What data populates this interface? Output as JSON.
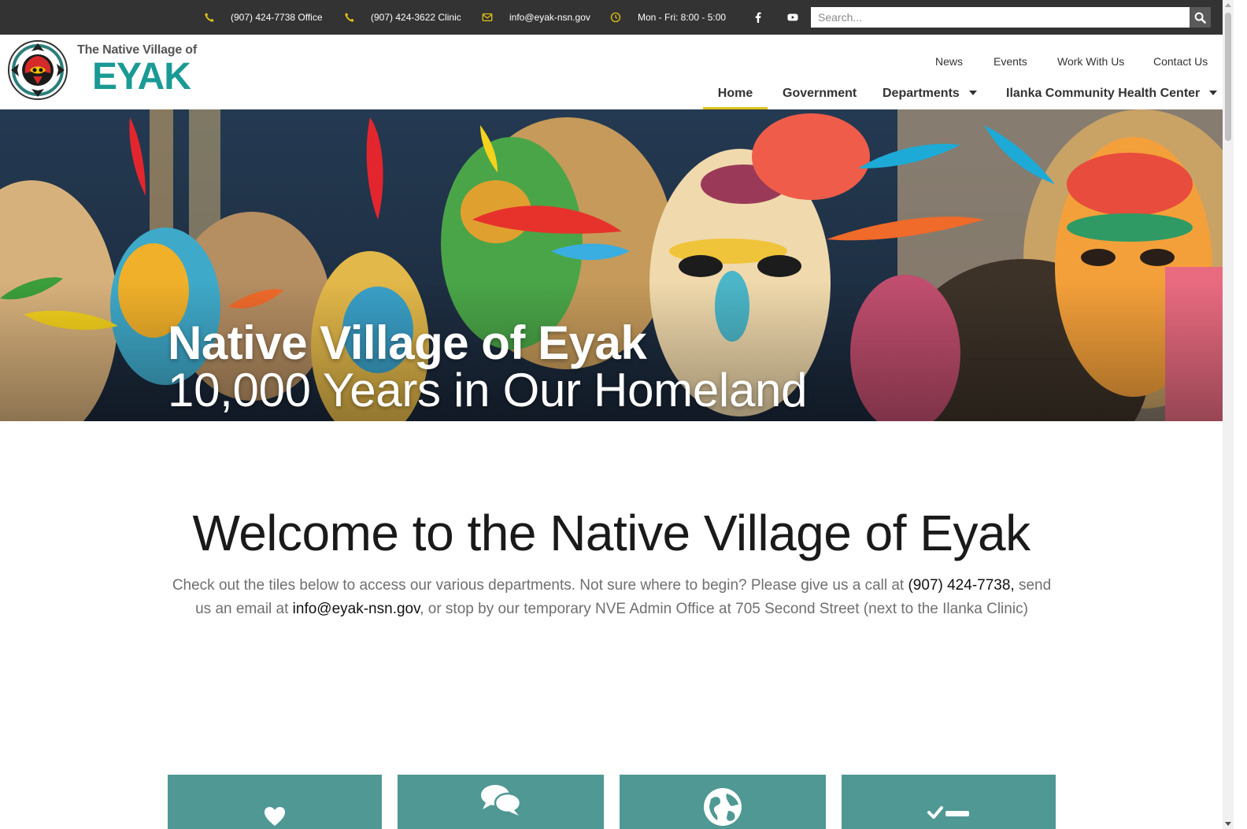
{
  "topbar": {
    "office_phone": "(907) 424-7738 Office",
    "clinic_phone": "(907) 424-3622 Clinic",
    "email": "info@eyak-nsn.gov",
    "hours": "Mon - Fri: 8:00 - 5:00",
    "social": [
      "facebook-icon",
      "youtube-icon"
    ],
    "search_placeholder": "Search...",
    "icon_color": "#e0c218"
  },
  "header": {
    "logo_line1": "The Native Village of",
    "logo_line2": "EYAK",
    "utility_links": {
      "news": "News",
      "events": "Events",
      "work": "Work With Us",
      "contact": "Contact Us"
    },
    "nav": {
      "home": "Home",
      "government": "Government",
      "departments": "Departments",
      "ilanka": "Ilanka Community Health Center"
    },
    "active_nav": "Home",
    "brand_color": "#1a9a95",
    "active_underline_color": "#e0c218"
  },
  "hero": {
    "title": "Native Village of Eyak",
    "subtitle": "10,000 Years in Our Homeland"
  },
  "welcome": {
    "title": "Welcome to the Native Village of Eyak",
    "text_part1": "Check out the tiles below to access our various departments. Not sure where to begin? Please give us a call at ",
    "phone_link": "(907) 424-7738,",
    "text_part2": " send us an email at ",
    "email_link": "info@eyak-nsn.gov",
    "text_part3": ", or stop by our temporary NVE Admin Office at 705 Second Street (next to the Ilanka Clinic)"
  },
  "tiles": {
    "color": "#4f9894",
    "icons": [
      "heart-icon",
      "comments-icon",
      "globe-icon",
      "tasks-icon"
    ]
  }
}
